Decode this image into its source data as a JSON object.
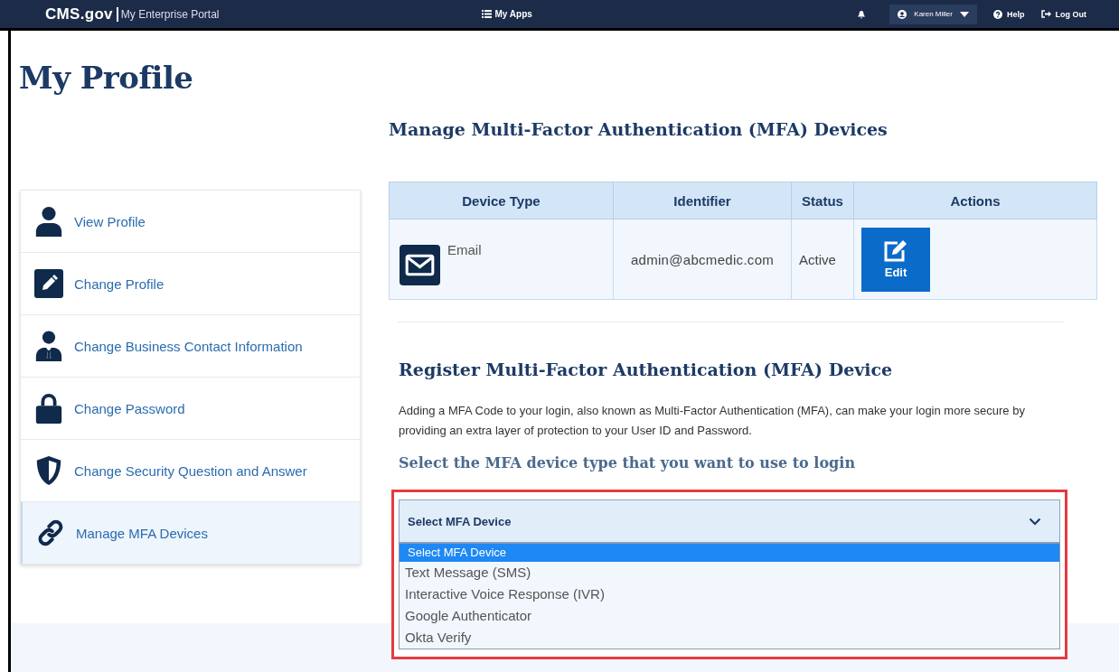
{
  "header": {
    "logo": "CMS.gov",
    "portal": "My Enterprise Portal",
    "apps": "My Apps",
    "user": "Karen Miller",
    "help": "Help",
    "logout": "Log Out"
  },
  "page_title": "My Profile",
  "sidebar": {
    "items": [
      {
        "label": "View Profile",
        "kind": "person",
        "selected": false
      },
      {
        "label": "Change Profile",
        "kind": "pencil",
        "selected": false
      },
      {
        "label": "Change Business Contact Information",
        "kind": "business",
        "selected": false
      },
      {
        "label": "Change Password",
        "kind": "lock",
        "selected": false
      },
      {
        "label": "Change Security Question and Answer",
        "kind": "shield",
        "selected": false
      },
      {
        "label": "Manage MFA Devices",
        "kind": "link",
        "selected": true
      }
    ]
  },
  "devices": {
    "heading": "Manage Multi-Factor Authentication (MFA) Devices",
    "columns": [
      "Device Type",
      "Identifier",
      "Status",
      "Actions"
    ],
    "rows": [
      {
        "type": "Email",
        "identifier": "admin@abcmedic.com",
        "status": "Active",
        "action": "Edit"
      }
    ]
  },
  "register": {
    "heading": "Register Multi-Factor Authentication (MFA) Device",
    "description": "Adding a MFA Code to your login, also known as Multi-Factor Authentication (MFA), can make your login more secure by providing an extra layer of protection to your User ID and Password.",
    "prompt": "Select the MFA device type that you want to use to login",
    "select": {
      "value": "Select MFA Device",
      "expanded": true,
      "options": [
        {
          "label": "Select MFA Device",
          "selected": true
        },
        {
          "label": "Text Message (SMS)",
          "selected": false
        },
        {
          "label": "Interactive Voice Response (IVR)",
          "selected": false
        },
        {
          "label": "Google Authenticator",
          "selected": false
        },
        {
          "label": "Okta Verify",
          "selected": false
        }
      ]
    }
  }
}
